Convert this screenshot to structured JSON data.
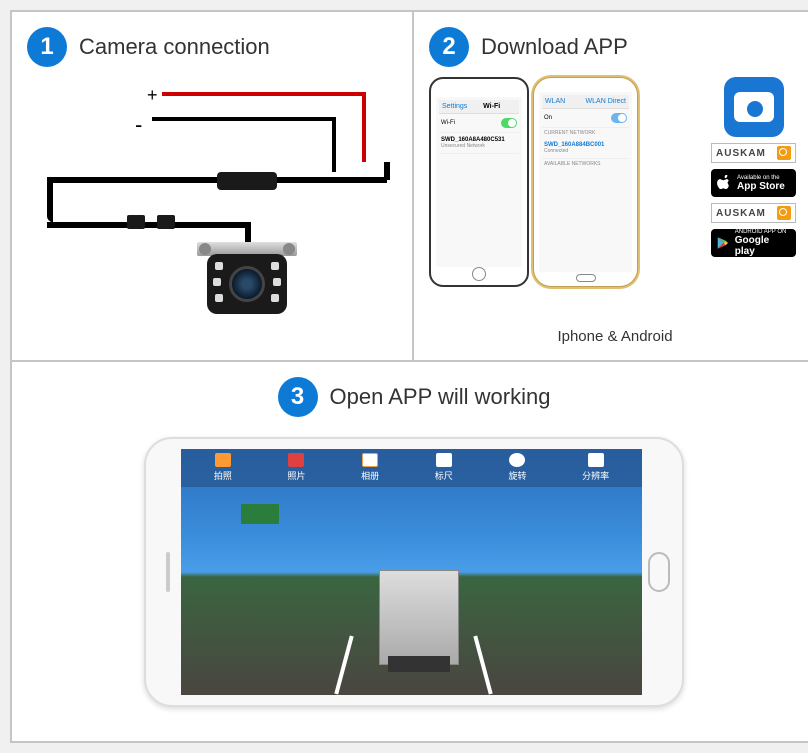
{
  "step1": {
    "num": "1",
    "title": "Camera connection",
    "plus": "+",
    "minus": "-"
  },
  "step2": {
    "num": "2",
    "title": "Download APP",
    "caption": "Iphone & Android",
    "iphone": {
      "back": "Settings",
      "header": "Wi-Fi",
      "wifi_label": "Wi-Fi",
      "network": "SWD_160A8A480C531",
      "network_sub": "Unsecured Network"
    },
    "android": {
      "header_left": "WLAN",
      "header_right": "WLAN Direct",
      "on": "On",
      "current": "CURRENT NETWORK",
      "network": "SWD_160A884BC001",
      "connected": "Connected",
      "available": "AVAILABLE NETWORKS"
    },
    "auskam": "AUSKAM",
    "appstore": {
      "line1": "Available on the",
      "line2": "App Store"
    },
    "play": {
      "line1": "ANDROID APP ON",
      "line2": "Google play"
    }
  },
  "step3": {
    "num": "3",
    "title": "Open APP will working",
    "toolbar": [
      "拍照",
      "照片",
      "相册",
      "标尺",
      "旋转",
      "分辨率"
    ]
  }
}
